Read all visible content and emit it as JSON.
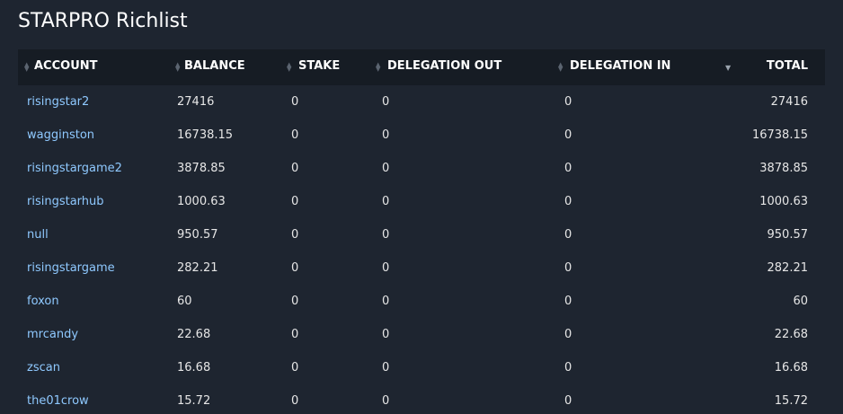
{
  "page": {
    "title": "STARPRO Richlist"
  },
  "table": {
    "headers": {
      "account": "ACCOUNT",
      "balance": "BALANCE",
      "stake": "STAKE",
      "delegation_out": "DELEGATION OUT",
      "delegation_in": "DELEGATION IN",
      "total": "TOTAL"
    },
    "sort": {
      "column": "total",
      "direction": "descending"
    },
    "rows": [
      {
        "account": "risingstar2",
        "balance": "27416",
        "stake": "0",
        "delegation_out": "0",
        "delegation_in": "0",
        "total": "27416"
      },
      {
        "account": "wagginston",
        "balance": "16738.15",
        "stake": "0",
        "delegation_out": "0",
        "delegation_in": "0",
        "total": "16738.15"
      },
      {
        "account": "risingstargame2",
        "balance": "3878.85",
        "stake": "0",
        "delegation_out": "0",
        "delegation_in": "0",
        "total": "3878.85"
      },
      {
        "account": "risingstarhub",
        "balance": "1000.63",
        "stake": "0",
        "delegation_out": "0",
        "delegation_in": "0",
        "total": "1000.63"
      },
      {
        "account": "null",
        "balance": "950.57",
        "stake": "0",
        "delegation_out": "0",
        "delegation_in": "0",
        "total": "950.57"
      },
      {
        "account": "risingstargame",
        "balance": "282.21",
        "stake": "0",
        "delegation_out": "0",
        "delegation_in": "0",
        "total": "282.21"
      },
      {
        "account": "foxon",
        "balance": "60",
        "stake": "0",
        "delegation_out": "0",
        "delegation_in": "0",
        "total": "60"
      },
      {
        "account": "mrcandy",
        "balance": "22.68",
        "stake": "0",
        "delegation_out": "0",
        "delegation_in": "0",
        "total": "22.68"
      },
      {
        "account": "zscan",
        "balance": "16.68",
        "stake": "0",
        "delegation_out": "0",
        "delegation_in": "0",
        "total": "16.68"
      },
      {
        "account": "the01crow",
        "balance": "15.72",
        "stake": "0",
        "delegation_out": "0",
        "delegation_in": "0",
        "total": "15.72"
      }
    ]
  },
  "colors": {
    "background": "#1e2530",
    "header_background": "#161c24",
    "link": "#8fc9ff",
    "text": "#e6e6e6"
  }
}
